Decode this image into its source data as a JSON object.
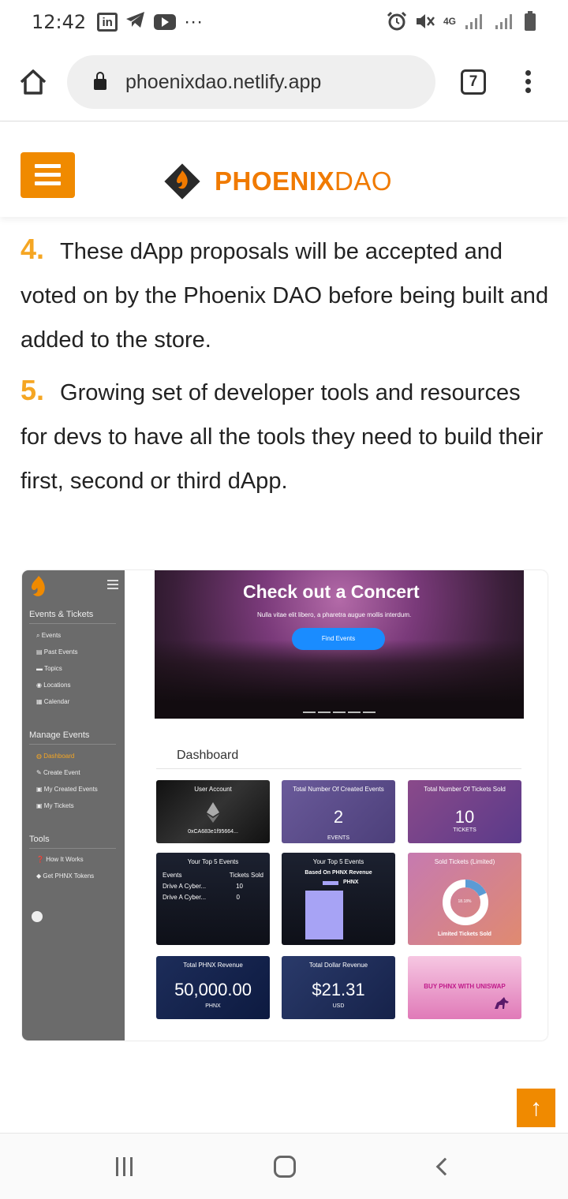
{
  "status_bar": {
    "time": "12:42",
    "more": "···",
    "network": "4G"
  },
  "browser": {
    "url": "phoenixdao.netlify.app",
    "tab_count": "7"
  },
  "site_header": {
    "logo_primary": "PHOENIX",
    "logo_secondary": "DAO",
    "brand_color": "#f07a00"
  },
  "content": {
    "items": [
      {
        "number": "4.",
        "text": "These dApp proposals will be accepted and voted on by the Phoenix DAO before being built and added to the store."
      },
      {
        "number": "5.",
        "text": "Growing set of developer tools and resources for devs to have all the tools they need to build their first, second or third dApp."
      }
    ]
  },
  "screenshot": {
    "sidebar": {
      "section_events": "Events & Tickets",
      "events_links": [
        "Events",
        "Past Events",
        "Topics",
        "Locations",
        "Calendar"
      ],
      "section_manage": "Manage Events",
      "manage_links": [
        "Dashboard",
        "Create Event",
        "My Created Events",
        "My Tickets"
      ],
      "section_tools": "Tools",
      "tools_links": [
        "How It Works",
        "Get PHNX Tokens"
      ]
    },
    "hero": {
      "title": "Check out a Concert",
      "subtitle": "Nulla vitae elit libero, a pharetra augue mollis interdum.",
      "button": "Find Events"
    },
    "dashboard": {
      "title": "Dashboard",
      "user_account": {
        "title": "User Account",
        "address": "0xCA683e1f95664..."
      },
      "created_events": {
        "title": "Total Number Of Created Events",
        "value": "2",
        "unit": "EVENTS"
      },
      "tickets_sold": {
        "title": "Total Number Of Tickets Sold",
        "value": "10",
        "unit": "TICKETS"
      },
      "top5_events": {
        "title": "Your Top 5 Events",
        "col1": "Events",
        "col2": "Tickets Sold",
        "rows": [
          {
            "name": "Drive A Cyber...",
            "sold": "10"
          },
          {
            "name": "Drive A Cyber...",
            "sold": "0"
          }
        ]
      },
      "top5_revenue": {
        "title": "Your Top 5 Events",
        "subtitle": "Based On PHNX Revenue",
        "legend": "PHNX"
      },
      "sold_limited": {
        "title": "Sold Tickets (Limited)",
        "percent": "18.18%",
        "caption": "Limited Tickets Sold"
      },
      "phnx_revenue": {
        "title": "Total PHNX Revenue",
        "value": "50,000.00",
        "unit": "PHNX"
      },
      "dollar_revenue": {
        "title": "Total Dollar Revenue",
        "value": "$21.31",
        "unit": "USD"
      },
      "uniswap": {
        "label": "BUY PHNX WITH UNISWAP"
      }
    }
  },
  "scroll_top": "↑"
}
